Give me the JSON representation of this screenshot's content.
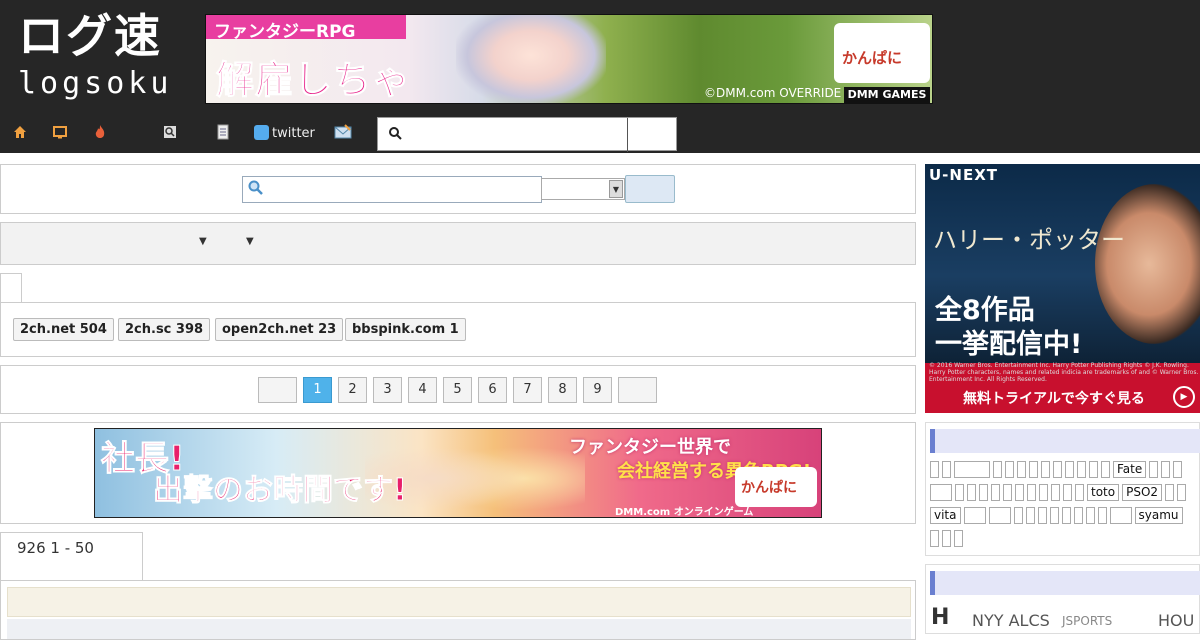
{
  "header": {
    "logo_jp": "ログ速",
    "logo_en": "logsoku",
    "twitter_label": "twitter",
    "top_banner": {
      "ribbon_text": "ファンタジーRPG",
      "headline": "解雇しちゃ",
      "logo_text": "かんぱに",
      "copyright": "©DMM.com OVERRIDE",
      "brand": "DMM GAMES"
    }
  },
  "icons": {
    "home": "home-icon",
    "monitor": "monitor-icon",
    "fire": "fire-icon",
    "search": "search-icon",
    "list": "list-icon",
    "twitter": "twitter-icon",
    "mail": "mail-icon"
  },
  "boards": [
    {
      "label": "2ch.net 504"
    },
    {
      "label": "2ch.sc 398"
    },
    {
      "label": "open2ch.net 23"
    },
    {
      "label": "bbspink.com 1"
    }
  ],
  "pagination": {
    "pages": [
      "1",
      "2",
      "3",
      "4",
      "5",
      "6",
      "7",
      "8",
      "9"
    ],
    "current": "1"
  },
  "mid_banner": {
    "line1": "社長!",
    "line2": "出撃のお時間です!",
    "line3": "ファンタジー世界で",
    "line4": "会社経営する異色RPG!",
    "logo_text": "かんぱに",
    "footer": "DMM.com オンラインゲーム"
  },
  "results": {
    "tab_label": "926 1 - 50"
  },
  "side_ad": {
    "brand": "U-NEXT",
    "title": "ハリー・ポッター",
    "line1": "全8作品",
    "line2": "一挙配信中!",
    "fine_print": "© 2016 Warner Bros. Entertainment Inc. Harry Potter Publishing Rights © J.K. Rowling. Harry Potter characters, names and related indicia are trademarks of and © Warner Bros. Entertainment Inc. All Rights Reserved.",
    "cta": "無料トライアルで今すぐ見る"
  },
  "side_tags": [
    "Fate",
    "toto",
    "PSO2",
    "vita",
    "syamu"
  ],
  "side_news": {
    "h": "H",
    "n1": "NYY ALCS",
    "n2": "JSPORTS",
    "n3": "HOU"
  },
  "colors": {
    "header_bg": "#262626",
    "active_page": "#4fb2ea",
    "side_head": "#e4e6f8",
    "side_accent": "#6a7fd0"
  }
}
